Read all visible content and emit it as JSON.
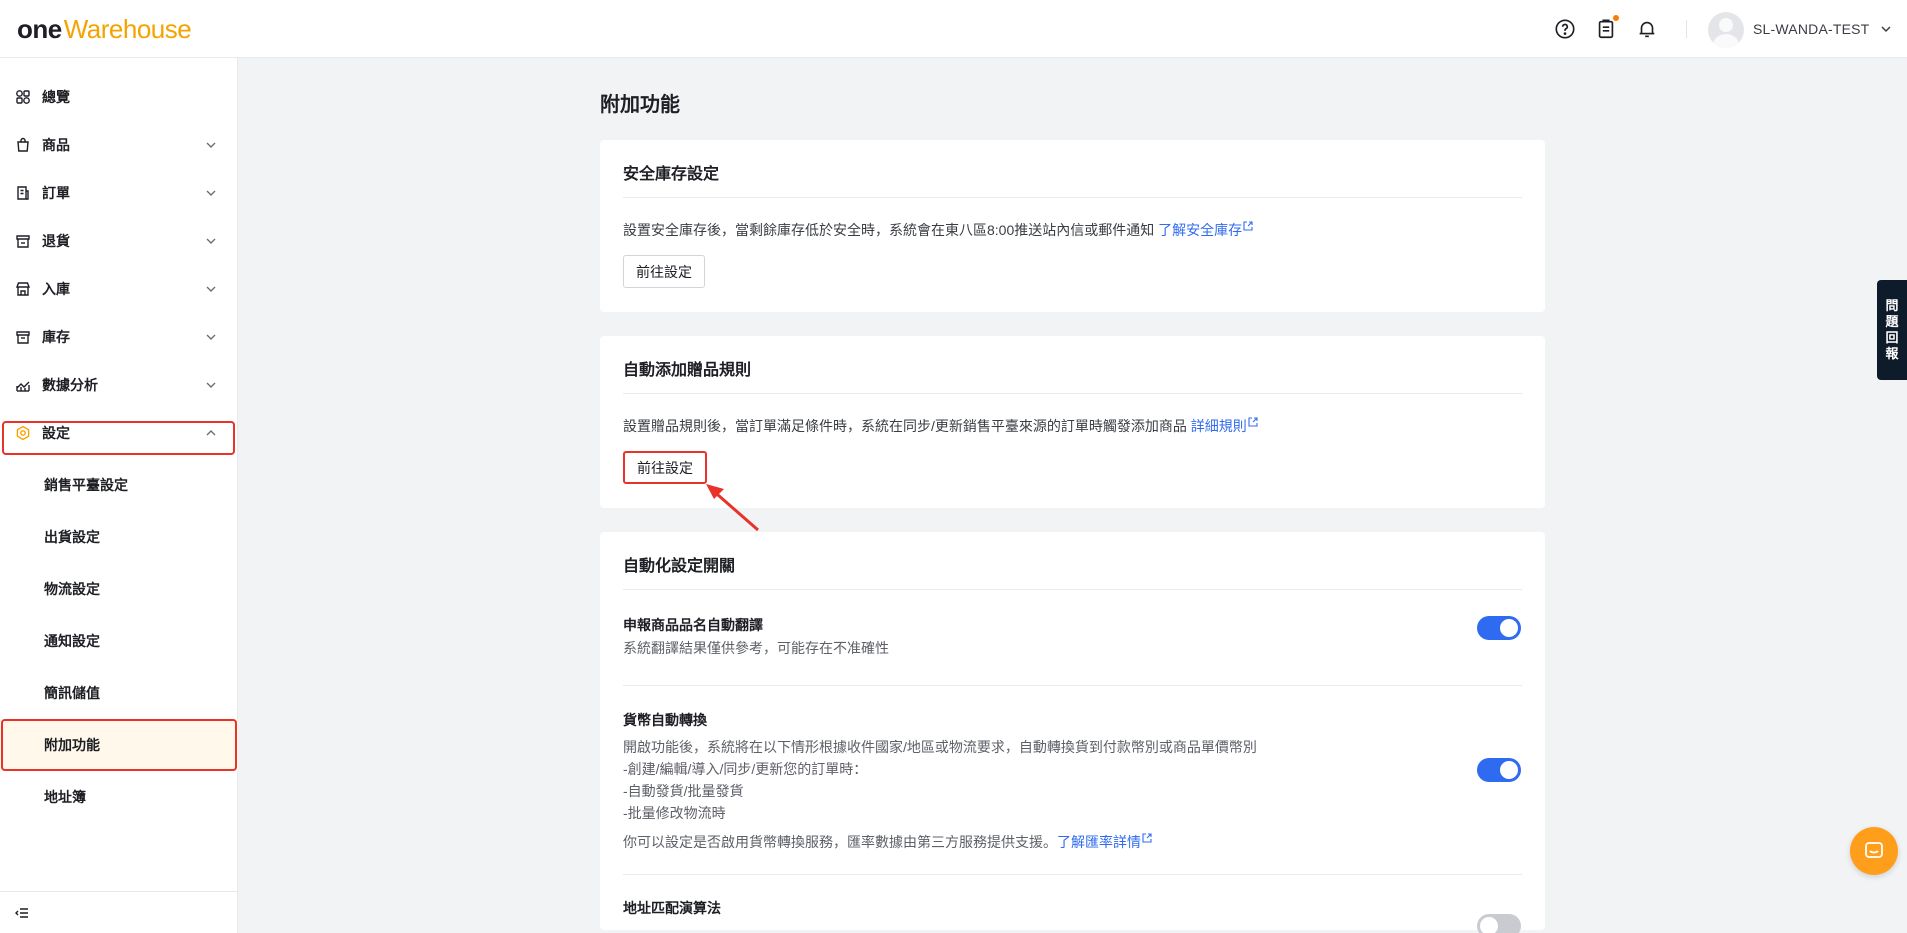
{
  "header": {
    "logo_one": "one",
    "logo_warehouse": "Warehouse",
    "username": "SL-WANDA-TEST",
    "icons": [
      "help-icon",
      "clipboard-icon",
      "bell-icon",
      "chevron-down-icon"
    ],
    "brand_color": "#f5a300"
  },
  "sidebar": {
    "items": [
      {
        "label": "總覽",
        "icon": "overview-icon",
        "has_chevron": false
      },
      {
        "label": "商品",
        "icon": "product-icon",
        "has_chevron": true
      },
      {
        "label": "訂單",
        "icon": "order-icon",
        "has_chevron": true
      },
      {
        "label": "退貨",
        "icon": "return-icon",
        "has_chevron": true
      },
      {
        "label": "入庫",
        "icon": "inbound-icon",
        "has_chevron": true
      },
      {
        "label": "庫存",
        "icon": "inventory-icon",
        "has_chevron": true
      },
      {
        "label": "數據分析",
        "icon": "analytics-icon",
        "has_chevron": true
      },
      {
        "label": "設定",
        "icon": "settings-icon",
        "has_chevron": true,
        "expanded": true
      }
    ],
    "sub_items": [
      {
        "label": "銷售平臺設定"
      },
      {
        "label": "出貨設定"
      },
      {
        "label": "物流設定"
      },
      {
        "label": "通知設定"
      },
      {
        "label": "簡訊儲值"
      },
      {
        "label": "附加功能",
        "active": true
      },
      {
        "label": "地址簿"
      }
    ]
  },
  "page": {
    "title": "附加功能"
  },
  "cards": {
    "safety_stock": {
      "title": "安全庫存設定",
      "desc": "設置安全庫存後，當剩餘庫存低於安全時，系統會在東八區8:00推送站內信或郵件通知",
      "link": "了解安全庫存",
      "button": "前往設定"
    },
    "gift_rule": {
      "title": "自動添加贈品規則",
      "desc": "設置贈品規則後，當訂單滿足條件時，系統在同步/更新銷售平臺來源的訂單時觸發添加商品",
      "link": "詳細規則",
      "button": "前往設定"
    },
    "automation": {
      "title": "自動化設定開關",
      "translate": {
        "title": "申報商品品名自動翻譯",
        "desc": "系統翻譯結果僅供參考，可能存在不准確性",
        "enabled": true
      },
      "currency": {
        "title": "貨幣自動轉換",
        "line1": "開啟功能後，系統將在以下情形根據收件國家/地區或物流要求，自動轉換貨到付款幣別或商品單價幣別",
        "line2": "-創建/編輯/導入/同步/更新您的訂單時：",
        "line3": "-自動發貨/批量發貨",
        "line4": "-批量修改物流時",
        "line5": "你可以設定是否啟用貨幣轉換服務，匯率數據由第三方服務提供支援。",
        "link": "了解匯率詳情",
        "enabled": true
      },
      "address": {
        "title": "地址匹配演算法",
        "enabled": false
      }
    }
  },
  "floating": {
    "feedback_chars": [
      "問",
      "題",
      "回",
      "報"
    ],
    "chat_color": "#ff9e1b"
  },
  "colors": {
    "accent": "#2f6bf0",
    "highlight": "#e8322a"
  }
}
